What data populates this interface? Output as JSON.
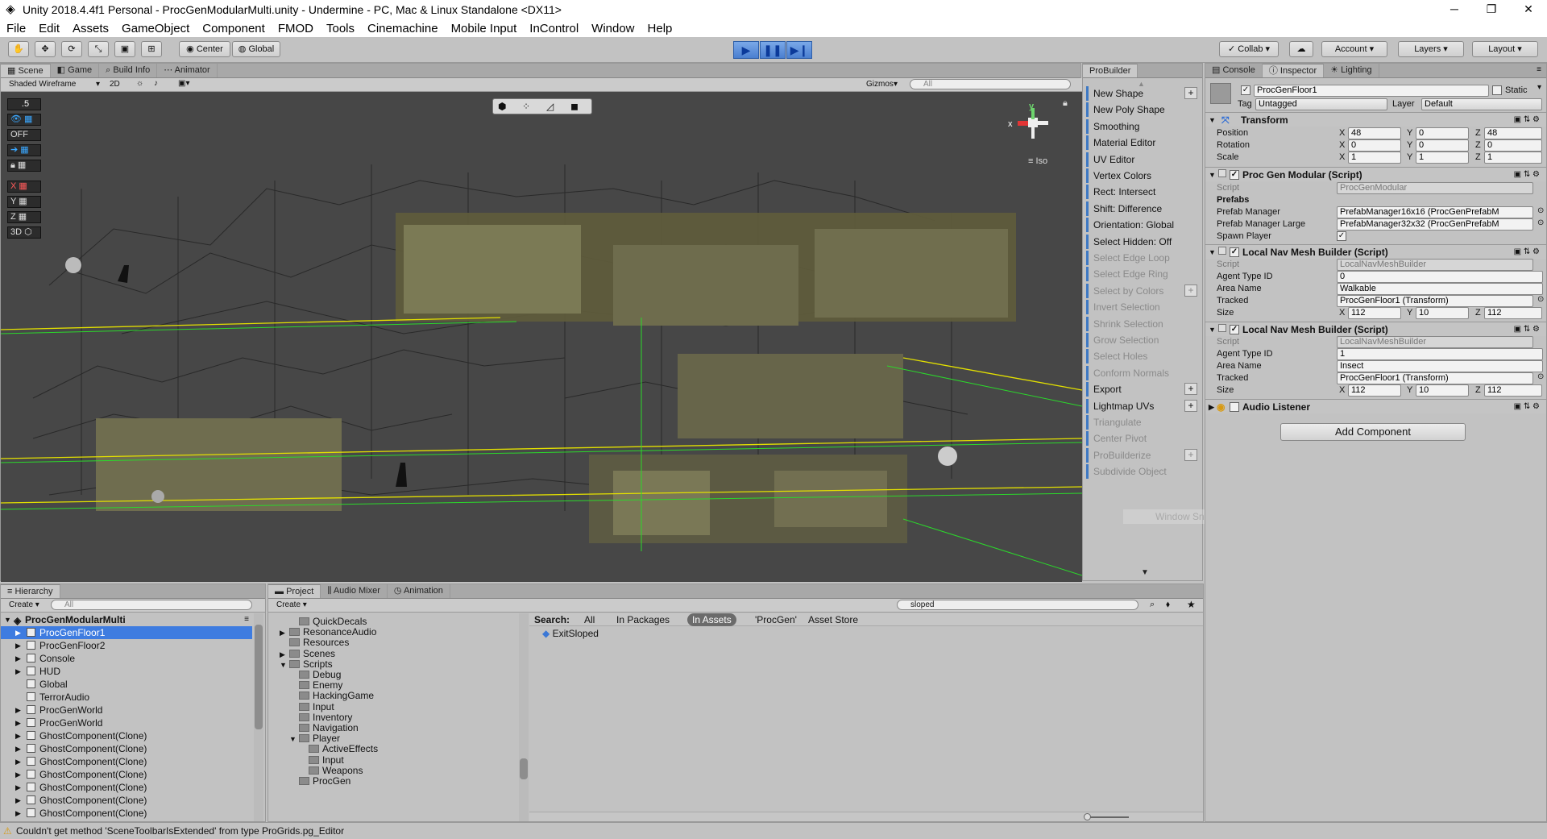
{
  "window": {
    "title": "Unity 2018.4.4f1 Personal - ProcGenModularMulti.unity - Undermine - PC, Mac & Linux Standalone <DX11>"
  },
  "menu": [
    "File",
    "Edit",
    "Assets",
    "GameObject",
    "Component",
    "FMOD",
    "Tools",
    "Cinemachine",
    "Mobile Input",
    "InControl",
    "Window",
    "Help"
  ],
  "toolbar": {
    "center": "Center",
    "global": "Global",
    "collab": "Collab",
    "account": "Account",
    "layers": "Layers",
    "layout": "Layout"
  },
  "scene": {
    "tabs": [
      "Scene",
      "Game",
      "Build Info",
      "Animator"
    ],
    "draw_mode": "Shaded Wireframe",
    "mode_2d": "2D",
    "gizmos": "Gizmos",
    "search_placeholder": "All",
    "iso": "Iso",
    "grid_tools": [
      ".5",
      "",
      "OFF",
      "",
      "",
      "X",
      "Y",
      "Z",
      "3D"
    ]
  },
  "probuilder": {
    "tab": "ProBuilder",
    "items": [
      {
        "label": "New Shape",
        "enabled": true,
        "plus": true
      },
      {
        "label": "New Poly Shape",
        "enabled": true,
        "plus": false
      },
      {
        "label": "Smoothing",
        "enabled": true,
        "plus": false
      },
      {
        "label": "Material Editor",
        "enabled": true,
        "plus": false
      },
      {
        "label": "UV Editor",
        "enabled": true,
        "plus": false
      },
      {
        "label": "Vertex Colors",
        "enabled": true,
        "plus": false
      },
      {
        "label": "Rect: Intersect",
        "enabled": true,
        "plus": false
      },
      {
        "label": "Shift: Difference",
        "enabled": true,
        "plus": false
      },
      {
        "label": "Orientation: Global",
        "enabled": true,
        "plus": false
      },
      {
        "label": "Select Hidden: Off",
        "enabled": true,
        "plus": false
      },
      {
        "label": "Select Edge Loop",
        "enabled": false,
        "plus": false
      },
      {
        "label": "Select Edge Ring",
        "enabled": false,
        "plus": false
      },
      {
        "label": "Select by Colors",
        "enabled": false,
        "plus": true
      },
      {
        "label": "Invert Selection",
        "enabled": false,
        "plus": false
      },
      {
        "label": "Shrink Selection",
        "enabled": false,
        "plus": false
      },
      {
        "label": "Grow Selection",
        "enabled": false,
        "plus": false
      },
      {
        "label": "Select Holes",
        "enabled": false,
        "plus": false
      },
      {
        "label": "Conform Normals",
        "enabled": false,
        "plus": false
      },
      {
        "label": "Export",
        "enabled": true,
        "plus": true
      },
      {
        "label": "Lightmap UVs",
        "enabled": true,
        "plus": true
      },
      {
        "label": "Triangulate",
        "enabled": false,
        "plus": false
      },
      {
        "label": "Center Pivot",
        "enabled": false,
        "plus": false
      },
      {
        "label": "ProBuilderize",
        "enabled": false,
        "plus": true
      },
      {
        "label": "Subdivide Object",
        "enabled": false,
        "plus": false
      }
    ],
    "overlay": "Window Snip"
  },
  "inspector": {
    "tabs": [
      "Console",
      "Inspector",
      "Lighting"
    ],
    "object_name": "ProcGenFloor1",
    "static_label": "Static",
    "tag_label": "Tag",
    "tag_value": "Untagged",
    "layer_label": "Layer",
    "layer_value": "Default",
    "transform": {
      "title": "Transform",
      "position": {
        "label": "Position",
        "x": "48",
        "y": "0",
        "z": "48"
      },
      "rotation": {
        "label": "Rotation",
        "x": "0",
        "y": "0",
        "z": "0"
      },
      "scale": {
        "label": "Scale",
        "x": "1",
        "y": "1",
        "z": "1"
      }
    },
    "procgen": {
      "title": "Proc Gen Modular (Script)",
      "script_label": "Script",
      "script_value": "ProcGenModular",
      "prefabs_header": "Prefabs",
      "pm_label": "Prefab Manager",
      "pm_value": "PrefabManager16x16 (ProcGenPrefabM",
      "pml_label": "Prefab Manager Large",
      "pml_value": "PrefabManager32x32 (ProcGenPrefabM",
      "spawn_label": "Spawn Player"
    },
    "nav1": {
      "title": "Local Nav Mesh Builder (Script)",
      "script_label": "Script",
      "script_value": "LocalNavMeshBuilder",
      "agent_label": "Agent Type ID",
      "agent_value": "0",
      "area_label": "Area Name",
      "area_value": "Walkable",
      "tracked_label": "Tracked",
      "tracked_value": "ProcGenFloor1 (Transform)",
      "size_label": "Size",
      "x": "112",
      "y": "10",
      "z": "112"
    },
    "nav2": {
      "title": "Local Nav Mesh Builder (Script)",
      "script_label": "Script",
      "script_value": "LocalNavMeshBuilder",
      "agent_label": "Agent Type ID",
      "agent_value": "1",
      "area_label": "Area Name",
      "area_value": "Insect",
      "tracked_label": "Tracked",
      "tracked_value": "ProcGenFloor1 (Transform)",
      "size_label": "Size",
      "x": "112",
      "y": "10",
      "z": "112"
    },
    "audio": {
      "title": "Audio Listener"
    },
    "add_component": "Add Component",
    "axis": {
      "x": "X",
      "y": "Y",
      "z": "Z"
    }
  },
  "hierarchy": {
    "tab": "Hierarchy",
    "create": "Create",
    "search_placeholder": "All",
    "scene_name": "ProcGenModularMulti",
    "items": [
      {
        "label": "ProcGenFloor1",
        "selected": true,
        "arrow": true
      },
      {
        "label": "ProcGenFloor2",
        "selected": false,
        "arrow": true
      },
      {
        "label": "Console",
        "selected": false,
        "arrow": true
      },
      {
        "label": "HUD",
        "selected": false,
        "arrow": true
      },
      {
        "label": "Global",
        "selected": false,
        "arrow": false
      },
      {
        "label": "TerrorAudio",
        "selected": false,
        "arrow": false
      },
      {
        "label": "ProcGenWorld",
        "selected": false,
        "arrow": true
      },
      {
        "label": "ProcGenWorld",
        "selected": false,
        "arrow": true
      },
      {
        "label": "GhostComponent(Clone)",
        "selected": false,
        "arrow": true
      },
      {
        "label": "GhostComponent(Clone)",
        "selected": false,
        "arrow": true
      },
      {
        "label": "GhostComponent(Clone)",
        "selected": false,
        "arrow": true
      },
      {
        "label": "GhostComponent(Clone)",
        "selected": false,
        "arrow": true
      },
      {
        "label": "GhostComponent(Clone)",
        "selected": false,
        "arrow": true
      },
      {
        "label": "GhostComponent(Clone)",
        "selected": false,
        "arrow": true
      },
      {
        "label": "GhostComponent(Clone)",
        "selected": false,
        "arrow": true
      }
    ]
  },
  "project": {
    "tabs": [
      "Project",
      "Audio Mixer",
      "Animation"
    ],
    "create": "Create",
    "search_value": "sloped",
    "search_label": "Search:",
    "filters": [
      "All",
      "In Packages",
      "In Assets",
      "'ProcGen'",
      "Asset Store"
    ],
    "tree": [
      {
        "label": "QuickDecals",
        "depth": 1,
        "arrow": ""
      },
      {
        "label": "ResonanceAudio",
        "depth": 0,
        "arrow": "▶"
      },
      {
        "label": "Resources",
        "depth": 0,
        "arrow": ""
      },
      {
        "label": "Scenes",
        "depth": 0,
        "arrow": "▶"
      },
      {
        "label": "Scripts",
        "depth": 0,
        "arrow": "▼"
      },
      {
        "label": "Debug",
        "depth": 1,
        "arrow": ""
      },
      {
        "label": "Enemy",
        "depth": 1,
        "arrow": ""
      },
      {
        "label": "HackingGame",
        "depth": 1,
        "arrow": ""
      },
      {
        "label": "Input",
        "depth": 1,
        "arrow": ""
      },
      {
        "label": "Inventory",
        "depth": 1,
        "arrow": ""
      },
      {
        "label": "Navigation",
        "depth": 1,
        "arrow": ""
      },
      {
        "label": "Player",
        "depth": 1,
        "arrow": "▼"
      },
      {
        "label": "ActiveEffects",
        "depth": 2,
        "arrow": ""
      },
      {
        "label": "Input",
        "depth": 2,
        "arrow": ""
      },
      {
        "label": "Weapons",
        "depth": 2,
        "arrow": ""
      },
      {
        "label": "ProcGen",
        "depth": 1,
        "arrow": ""
      }
    ],
    "results": [
      "ExitSloped"
    ]
  },
  "status": {
    "message": "Couldn't get method 'SceneToolbarIsExtended' from type ProGrids.pg_Editor"
  }
}
